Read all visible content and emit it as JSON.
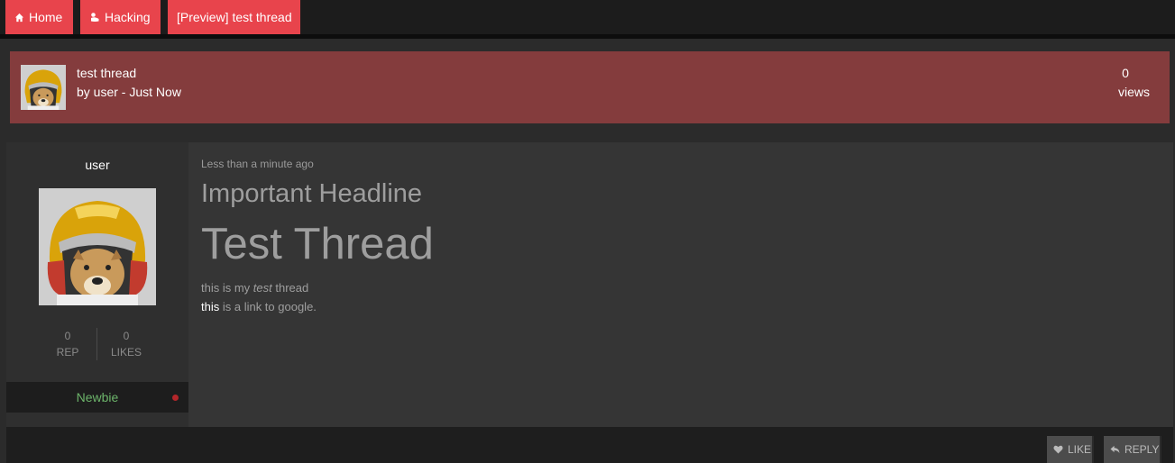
{
  "nav": {
    "home": "Home",
    "hacking": "Hacking",
    "preview": "[Preview] test thread"
  },
  "thread": {
    "title": "test thread",
    "byline": "by user - Just Now",
    "views_count": "0",
    "views_label": "views"
  },
  "author": {
    "username": "user",
    "rep_count": "0",
    "rep_label": "REP",
    "likes_count": "0",
    "likes_label": "LIKES",
    "rank": "Newbie"
  },
  "post": {
    "time": "Less than a minute ago",
    "headline": "Important Headline",
    "title": "Test Thread",
    "line1_a": "this is my ",
    "line1_em": "test",
    "line1_b": " thread",
    "link_text": "this",
    "line2_rest": " is a link to google."
  },
  "actions": {
    "like": "LIKE",
    "reply": "REPLY"
  },
  "colors": {
    "accent": "#e8444c",
    "thread_header": "#843c3d",
    "rank_green": "#6cb46a"
  },
  "icons": {
    "home": "home-icon",
    "hacking": "hacking-icon",
    "like": "heart-icon",
    "reply": "reply-icon",
    "avatar": "doge-astronaut-avatar"
  }
}
